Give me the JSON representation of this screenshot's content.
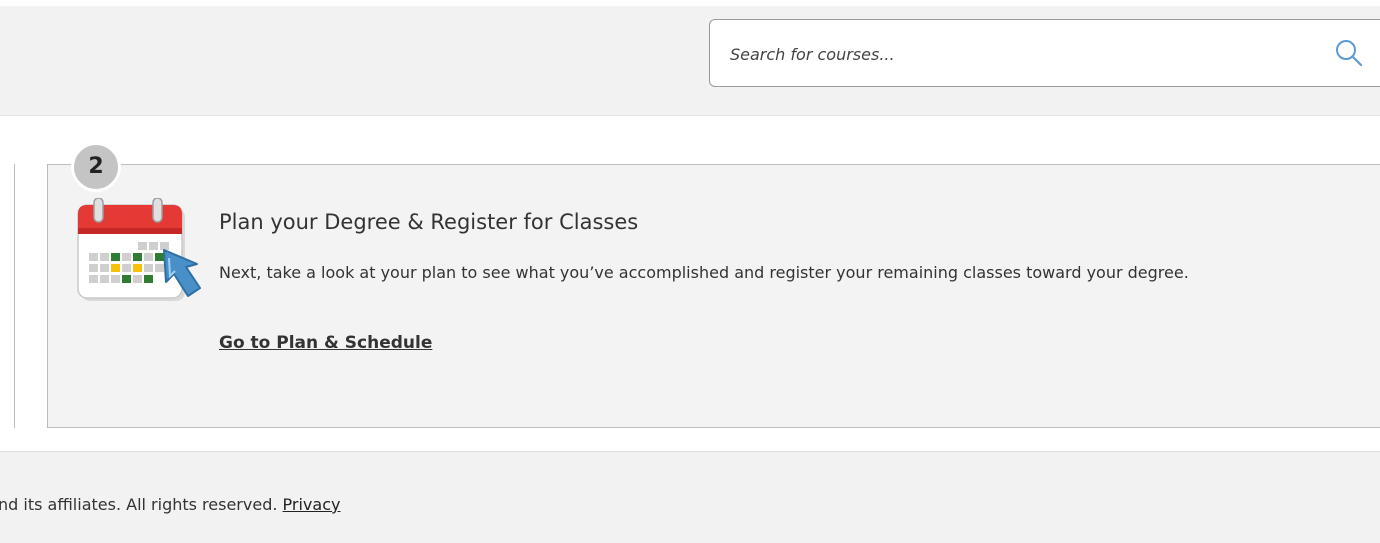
{
  "header": {
    "search": {
      "placeholder": "Search for courses...",
      "icon": "search-icon"
    }
  },
  "step_card": {
    "step_number": "2",
    "icon": "calendar-icon",
    "title": "Plan your Degree & Register for Classes",
    "description": "Next, take a look at your plan to see what you’ve accomplished and register your remaining classes toward your degree.",
    "link_label": "Go to Plan & Schedule"
  },
  "footer": {
    "copyright_text": "nd its affiliates. All rights reserved.",
    "privacy_label": "Privacy"
  },
  "colors": {
    "header_bg": "#f2f2f2",
    "card_bg": "#f3f3f3",
    "search_icon": "#5b9bd5",
    "calendar_red": "#e53935",
    "calendar_green": "#2e7d32",
    "calendar_yellow": "#f4c20d",
    "cursor_blue": "#4a90c8"
  }
}
